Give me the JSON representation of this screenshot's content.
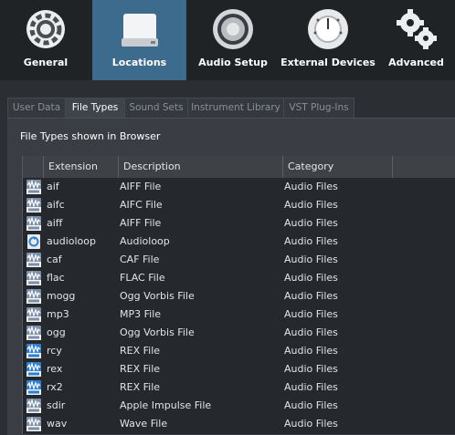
{
  "toolbar": [
    {
      "label": "General",
      "icon": "general-gear-icon"
    },
    {
      "label": "Locations",
      "icon": "drive-icon",
      "active": true
    },
    {
      "label": "Audio Setup",
      "icon": "speaker-icon"
    },
    {
      "label": "External Devices",
      "icon": "dial-icon"
    },
    {
      "label": "Advanced",
      "icon": "gears-icon"
    }
  ],
  "tabs": [
    "User Data",
    "File Types",
    "Sound Sets",
    "Instrument Library",
    "VST Plug-Ins"
  ],
  "active_tab": "File Types",
  "caption": "File Types shown in Browser",
  "columns": [
    "Extension",
    "Description",
    "Category"
  ],
  "rows": [
    {
      "ext": "aif",
      "desc": "AIFF File",
      "cat": "Audio Files",
      "icon": "aif"
    },
    {
      "ext": "aifc",
      "desc": "AIFC File",
      "cat": "Audio Files",
      "icon": "aif"
    },
    {
      "ext": "aiff",
      "desc": "AIFF File",
      "cat": "Audio Files",
      "icon": "aif"
    },
    {
      "ext": "audioloop",
      "desc": "Audioloop",
      "cat": "Audio Files",
      "icon": "loop"
    },
    {
      "ext": "caf",
      "desc": "CAF File",
      "cat": "Audio Files",
      "icon": "wave"
    },
    {
      "ext": "flac",
      "desc": "FLAC File",
      "cat": "Audio Files",
      "icon": "wave"
    },
    {
      "ext": "mogg",
      "desc": "Ogg Vorbis File",
      "cat": "Audio Files",
      "icon": "ogg"
    },
    {
      "ext": "mp3",
      "desc": "MP3 File",
      "cat": "Audio Files",
      "icon": "mp3"
    },
    {
      "ext": "ogg",
      "desc": "Ogg Vorbis File",
      "cat": "Audio Files",
      "icon": "ogg"
    },
    {
      "ext": "rcy",
      "desc": "REX File",
      "cat": "Audio Files",
      "icon": "rex"
    },
    {
      "ext": "rex",
      "desc": "REX File",
      "cat": "Audio Files",
      "icon": "rex"
    },
    {
      "ext": "rx2",
      "desc": "REX File",
      "cat": "Audio Files",
      "icon": "rex"
    },
    {
      "ext": "sdir",
      "desc": "Apple Impulse File",
      "cat": "Audio Files",
      "icon": "wave"
    },
    {
      "ext": "wav",
      "desc": "Wave File",
      "cat": "Audio Files",
      "icon": "wav"
    }
  ],
  "colors": {
    "accent": "#3d6b8e",
    "toolbar_bg": "#202326",
    "rex_blue": "#2f7fd0"
  }
}
